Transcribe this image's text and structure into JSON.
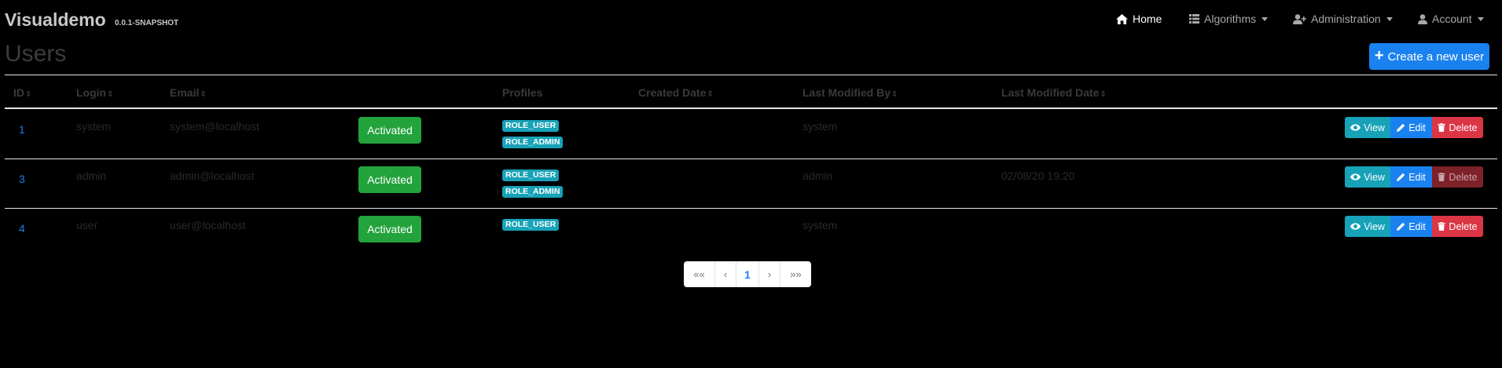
{
  "brand": {
    "name": "Visualdemo",
    "version": "0.0.1-SNAPSHOT"
  },
  "nav": [
    {
      "label": "Home",
      "icon": "home-icon",
      "active": true
    },
    {
      "label": "Algorithms",
      "icon": "th-list-icon",
      "dropdown": true
    },
    {
      "label": "Administration",
      "icon": "user-plus-icon",
      "dropdown": true
    },
    {
      "label": "Account",
      "icon": "user-icon",
      "dropdown": true
    }
  ],
  "page": {
    "title": "Users",
    "create_label": "Create a new user"
  },
  "table": {
    "headers": {
      "id": "ID",
      "login": "Login",
      "email": "Email",
      "profiles": "Profiles",
      "created_date": "Created Date",
      "last_modified_by": "Last Modified By",
      "last_modified_date": "Last Modified Date"
    },
    "rows": [
      {
        "id": "1",
        "login": "system",
        "email": "system@localhost",
        "status": "Activated",
        "roles": [
          "ROLE_USER",
          "ROLE_ADMIN"
        ],
        "created_date": "",
        "last_modified_by": "system",
        "last_modified_date": "",
        "delete_disabled": false
      },
      {
        "id": "3",
        "login": "admin",
        "email": "admin@localhost",
        "status": "Activated",
        "roles": [
          "ROLE_USER",
          "ROLE_ADMIN"
        ],
        "created_date": "",
        "last_modified_by": "admin",
        "last_modified_date": "02/08/20 19:20",
        "delete_disabled": true
      },
      {
        "id": "4",
        "login": "user",
        "email": "user@localhost",
        "status": "Activated",
        "roles": [
          "ROLE_USER"
        ],
        "created_date": "",
        "last_modified_by": "system",
        "last_modified_date": "",
        "delete_disabled": false
      }
    ],
    "actions": {
      "view": "View",
      "edit": "Edit",
      "delete": "Delete"
    },
    "sort_glyph": "⇕"
  },
  "pagination": {
    "first": "««",
    "prev": "‹",
    "current": "1",
    "next": "›",
    "last": "»»"
  },
  "colors": {
    "primary": "#1a82f0",
    "info": "#17a2b8",
    "success": "#23a33c",
    "danger": "#dc3545"
  }
}
